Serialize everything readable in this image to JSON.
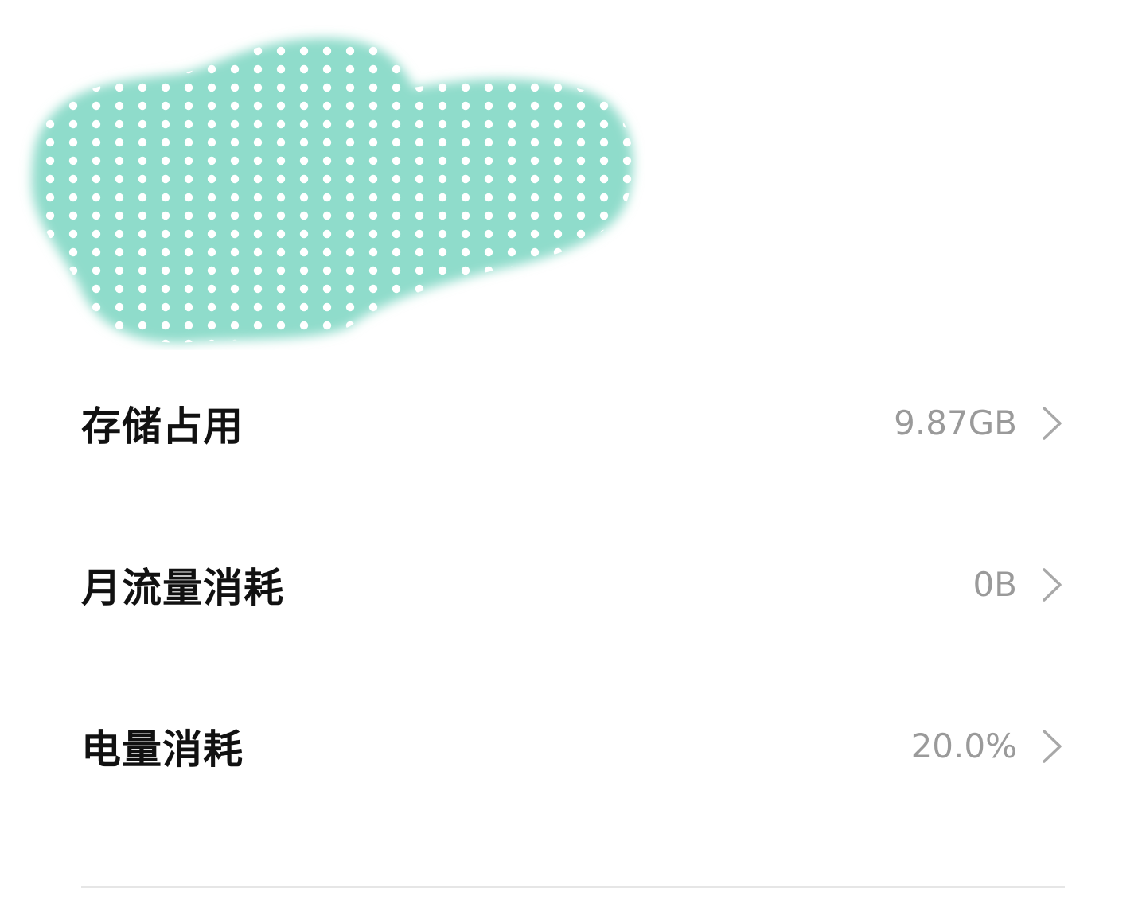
{
  "rows": [
    {
      "label": "存储占用",
      "value": "9.87GB"
    },
    {
      "label": "月流量消耗",
      "value": "0B"
    },
    {
      "label": "电量消耗",
      "value": "20.0%"
    }
  ],
  "icons": {
    "row_arrow": "chevron-right-icon"
  },
  "colors": {
    "redaction_fill": "#8fdccb",
    "label_text": "#111111",
    "value_text": "#9a9a9a"
  }
}
